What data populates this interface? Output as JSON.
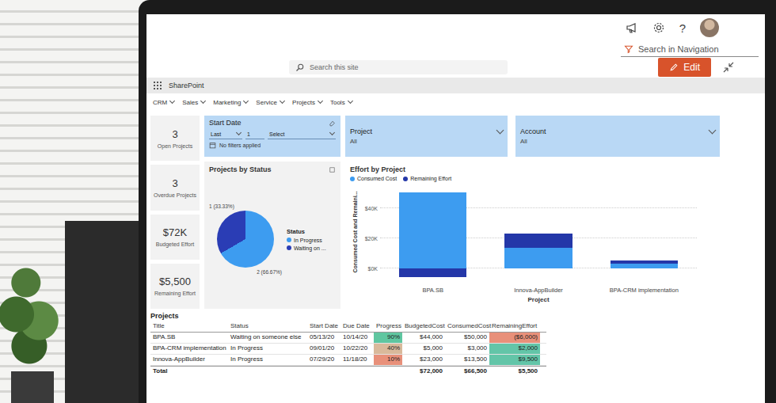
{
  "topbar": {
    "help": "?",
    "search_nav": "Search in Navigation",
    "edit": "Edit"
  },
  "suite": {
    "app": "SharePoint",
    "search_placeholder": "Search this site"
  },
  "nav": [
    {
      "label": "CRM"
    },
    {
      "label": "Sales"
    },
    {
      "label": "Marketing"
    },
    {
      "label": "Service"
    },
    {
      "label": "Projects"
    },
    {
      "label": "Tools"
    }
  ],
  "slicers": {
    "start_date": {
      "title": "Start Date",
      "relative": "Last",
      "count": "1",
      "unit": "Select",
      "status": "No filters applied"
    },
    "project": {
      "title": "Project",
      "value": "All"
    },
    "account": {
      "title": "Account",
      "value": "All"
    }
  },
  "kpis": [
    {
      "value": "3",
      "label": "Open Projects"
    },
    {
      "value": "3",
      "label": "Overdue Projects"
    },
    {
      "value": "$72K",
      "label": "Budgeted Effort"
    },
    {
      "value": "$5,500",
      "label": "Remaining Effort"
    }
  ],
  "pie": {
    "title": "Projects by Status",
    "legend_title": "Status",
    "slices": [
      {
        "label": "In Progress",
        "value": 2,
        "data_label": "2 (66.67%)",
        "color": "#3d9cf0"
      },
      {
        "label": "Waiting on ...",
        "value": 1,
        "data_label": "1 (33.33%)",
        "color": "#2a3db5"
      }
    ]
  },
  "bar_chart": {
    "title": "Effort by Project",
    "y_axis_title": "Consumed Cost and Remaini...",
    "x_axis_title": "Project",
    "ticks": [
      "$40K",
      "$20K",
      "$0K"
    ],
    "categories": [
      "BPA.SB",
      "Innova-AppBuilder",
      "BPA-CRM implementation"
    ],
    "series": [
      {
        "name": "Consumed Cost",
        "color": "#3d9cf0",
        "values": [
          50000,
          13500,
          3000
        ]
      },
      {
        "name": "Remaining Effort",
        "color": "#2437a8",
        "values": [
          -6000,
          9500,
          2000
        ]
      }
    ]
  },
  "table": {
    "title": "Projects",
    "columns": [
      "Title",
      "Status",
      "Start Date",
      "Due Date",
      "Progress",
      "BudgetedCost",
      "ConsumedCost",
      "RemainingEffort"
    ],
    "rows": [
      {
        "title": "BPA.SB",
        "status": "Waiting on someone else",
        "start": "05/13/20",
        "due": "10/14/20",
        "progress": "90%",
        "progress_color": "#5fc6a0",
        "budgeted": "$44,000",
        "consumed": "$50,000",
        "remaining": "($6,000)",
        "remaining_color": "#e8907a"
      },
      {
        "title": "BPA-CRM implementation",
        "status": "In Progress",
        "start": "09/01/20",
        "due": "10/22/20",
        "progress": "40%",
        "progress_color": "#d9b99b",
        "budgeted": "$5,000",
        "consumed": "$3,000",
        "remaining": "$2,000",
        "remaining_color": "#63c5a8"
      },
      {
        "title": "Innova-AppBuilder",
        "status": "In Progress",
        "start": "07/29/20",
        "due": "11/18/20",
        "progress": "10%",
        "progress_color": "#e8907a",
        "budgeted": "$23,000",
        "consumed": "$13,500",
        "remaining": "$9,500",
        "remaining_color": "#63c5a8"
      }
    ],
    "total": {
      "label": "Total",
      "budgeted": "$72,000",
      "consumed": "$66,500",
      "remaining": "$5,500"
    }
  }
}
